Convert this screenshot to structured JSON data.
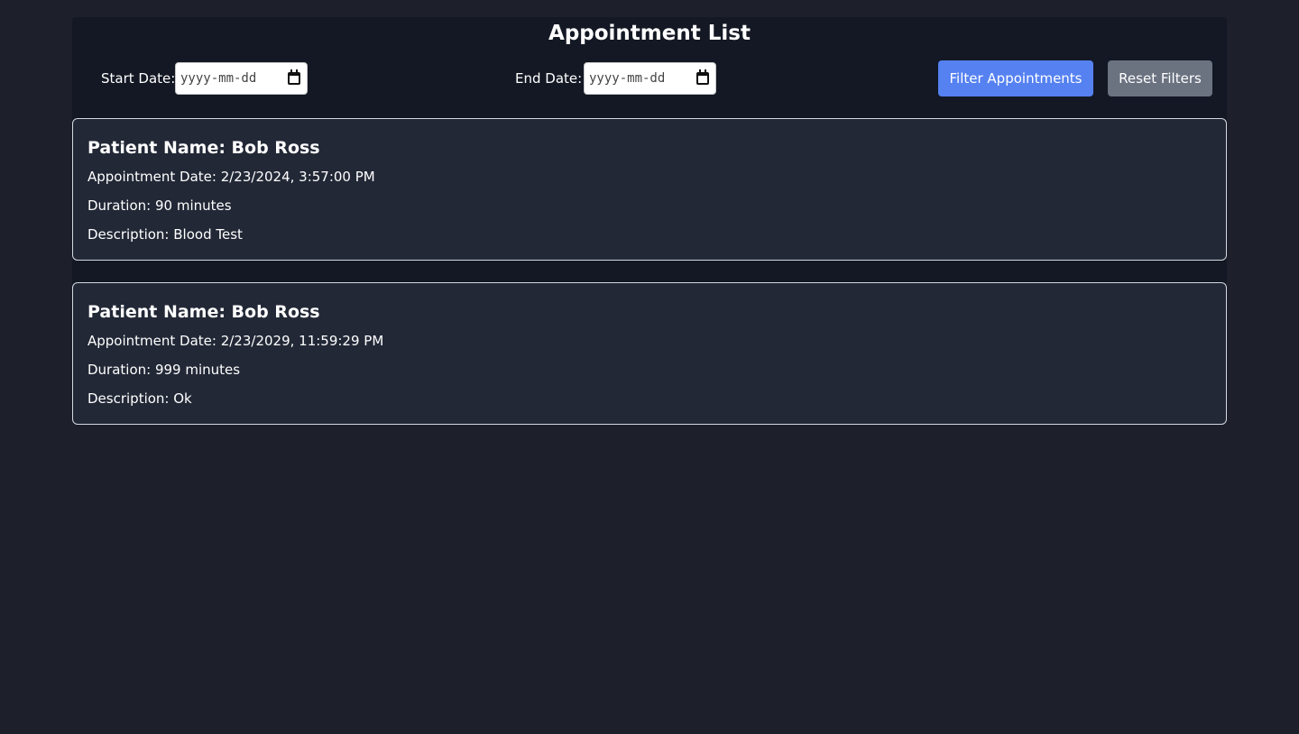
{
  "page": {
    "title": "Appointment List"
  },
  "filters": {
    "start_label": "Start Date:",
    "start_placeholder": "yyyy-mm-dd",
    "end_label": "End Date:",
    "end_placeholder": "yyyy-mm-dd",
    "filter_button": "Filter Appointments",
    "reset_button": "Reset Filters"
  },
  "appointments": [
    {
      "name": "Patient Name: Bob Ross",
      "date": "Appointment Date: 2/23/2024, 3:57:00 PM",
      "duration": "Duration: 90 minutes",
      "description": "Description: Blood Test"
    },
    {
      "name": "Patient Name: Bob Ross",
      "date": "Appointment Date: 2/23/2029, 11:59:29 PM",
      "duration": "Duration: 999 minutes",
      "description": "Description: Ok"
    }
  ],
  "colors": {
    "background": "#1d202b",
    "panel": "#131824",
    "card": "#222836",
    "primary_button": "#5581f1",
    "secondary_button": "#6b7280"
  },
  "icons": {
    "date_picker": "calendar-icon"
  }
}
